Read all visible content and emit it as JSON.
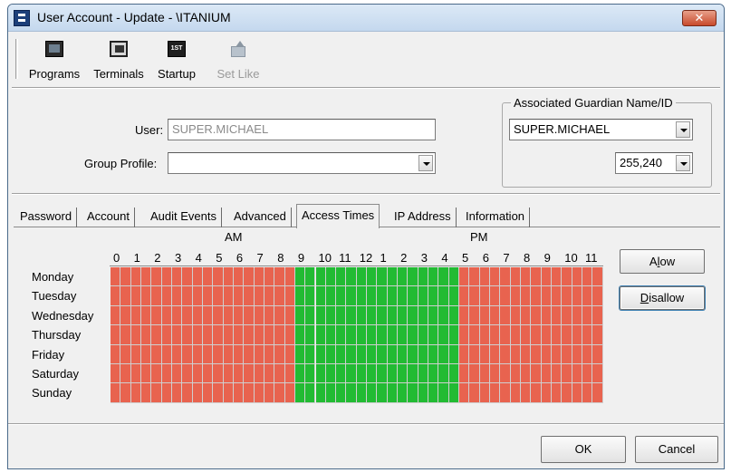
{
  "window": {
    "title": "User Account - Update - \\ITANIUM",
    "close_glyph": "✕"
  },
  "toolbar": {
    "programs": "Programs",
    "terminals": "Terminals",
    "startup": "Startup",
    "startup_icon_text": "1ST",
    "set_like": "Set Like"
  },
  "form": {
    "user_label": "User:",
    "user_value": "SUPER.MICHAEL",
    "group_profile_label": "Group Profile:",
    "group_profile_value": ""
  },
  "guardian": {
    "title": "Associated Guardian Name/ID",
    "name_value": "SUPER.MICHAEL",
    "id_value": "255,240"
  },
  "tabs": [
    {
      "label": "Password",
      "active": false
    },
    {
      "label": "Account",
      "active": false
    },
    {
      "label": "Audit Events",
      "active": false
    },
    {
      "label": "Advanced",
      "active": false
    },
    {
      "label": "Access Times",
      "active": true
    },
    {
      "label": "IP Address",
      "active": false
    },
    {
      "label": "Information",
      "active": false
    }
  ],
  "access_times": {
    "am_label": "AM",
    "pm_label": "PM",
    "hours": [
      "0",
      "1",
      "2",
      "3",
      "4",
      "5",
      "6",
      "7",
      "8",
      "9",
      "10",
      "11",
      "12",
      "1",
      "2",
      "3",
      "4",
      "5",
      "6",
      "7",
      "8",
      "9",
      "10",
      "11"
    ],
    "days": [
      "Monday",
      "Tuesday",
      "Wednesday",
      "Thursday",
      "Friday",
      "Saturday",
      "Sunday"
    ],
    "allowed_from_hour": 9,
    "allowed_to_hour": 17,
    "slots_per_hour": 2,
    "allowed_color": "#22bb33",
    "disallowed_color": "#e8634f"
  },
  "buttons": {
    "allow_prefix": "Al",
    "allow_mnemonic": "l",
    "allow_suffix": "ow",
    "disallow_mnemonic": "D",
    "disallow_suffix": "isallow",
    "ok": "OK",
    "cancel": "Cancel"
  }
}
